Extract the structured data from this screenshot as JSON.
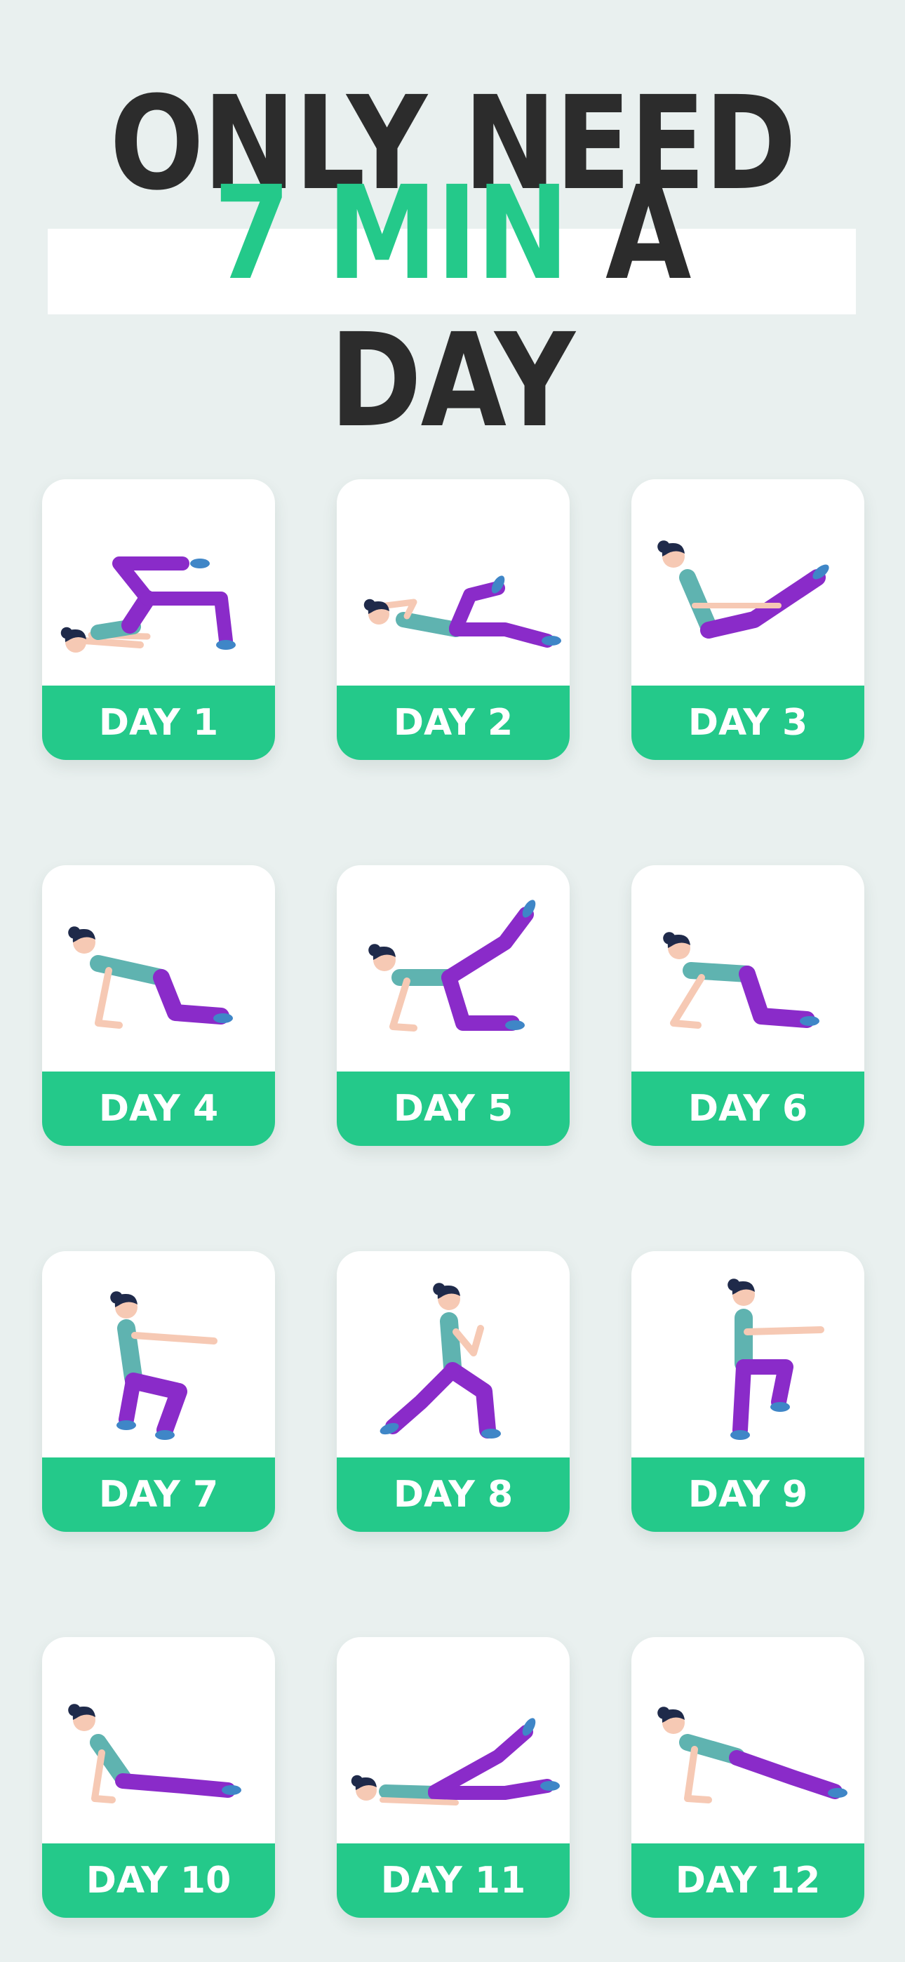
{
  "headline": {
    "line1": "ONLY NEED",
    "line2_accent": "7 MIN",
    "line2_rest": " A DAY"
  },
  "colors": {
    "background": "#e9f0ef",
    "accent": "#24c98a",
    "text_dark": "#2c2c2c",
    "card": "#ffffff",
    "outfit_top": "#5fb3b0",
    "outfit_pants": "#8a2bc9",
    "skin": "#f6c9b4",
    "hair": "#1f2a4a",
    "shoes": "#3f86c7"
  },
  "days": [
    {
      "label": "DAY 1",
      "pose": "glute-bridge-leg-raise-icon"
    },
    {
      "label": "DAY 2",
      "pose": "crunch-leg-raise-icon"
    },
    {
      "label": "DAY 3",
      "pose": "v-sit-hold-icon"
    },
    {
      "label": "DAY 4",
      "pose": "all-fours-hold-icon"
    },
    {
      "label": "DAY 5",
      "pose": "donkey-kick-icon"
    },
    {
      "label": "DAY 6",
      "pose": "cat-stretch-icon"
    },
    {
      "label": "DAY 7",
      "pose": "squat-icon"
    },
    {
      "label": "DAY 8",
      "pose": "lunge-icon"
    },
    {
      "label": "DAY 9",
      "pose": "high-knee-icon"
    },
    {
      "label": "DAY 10",
      "pose": "cobra-stretch-icon"
    },
    {
      "label": "DAY 11",
      "pose": "lying-leg-raise-icon"
    },
    {
      "label": "DAY 12",
      "pose": "plank-icon"
    }
  ]
}
